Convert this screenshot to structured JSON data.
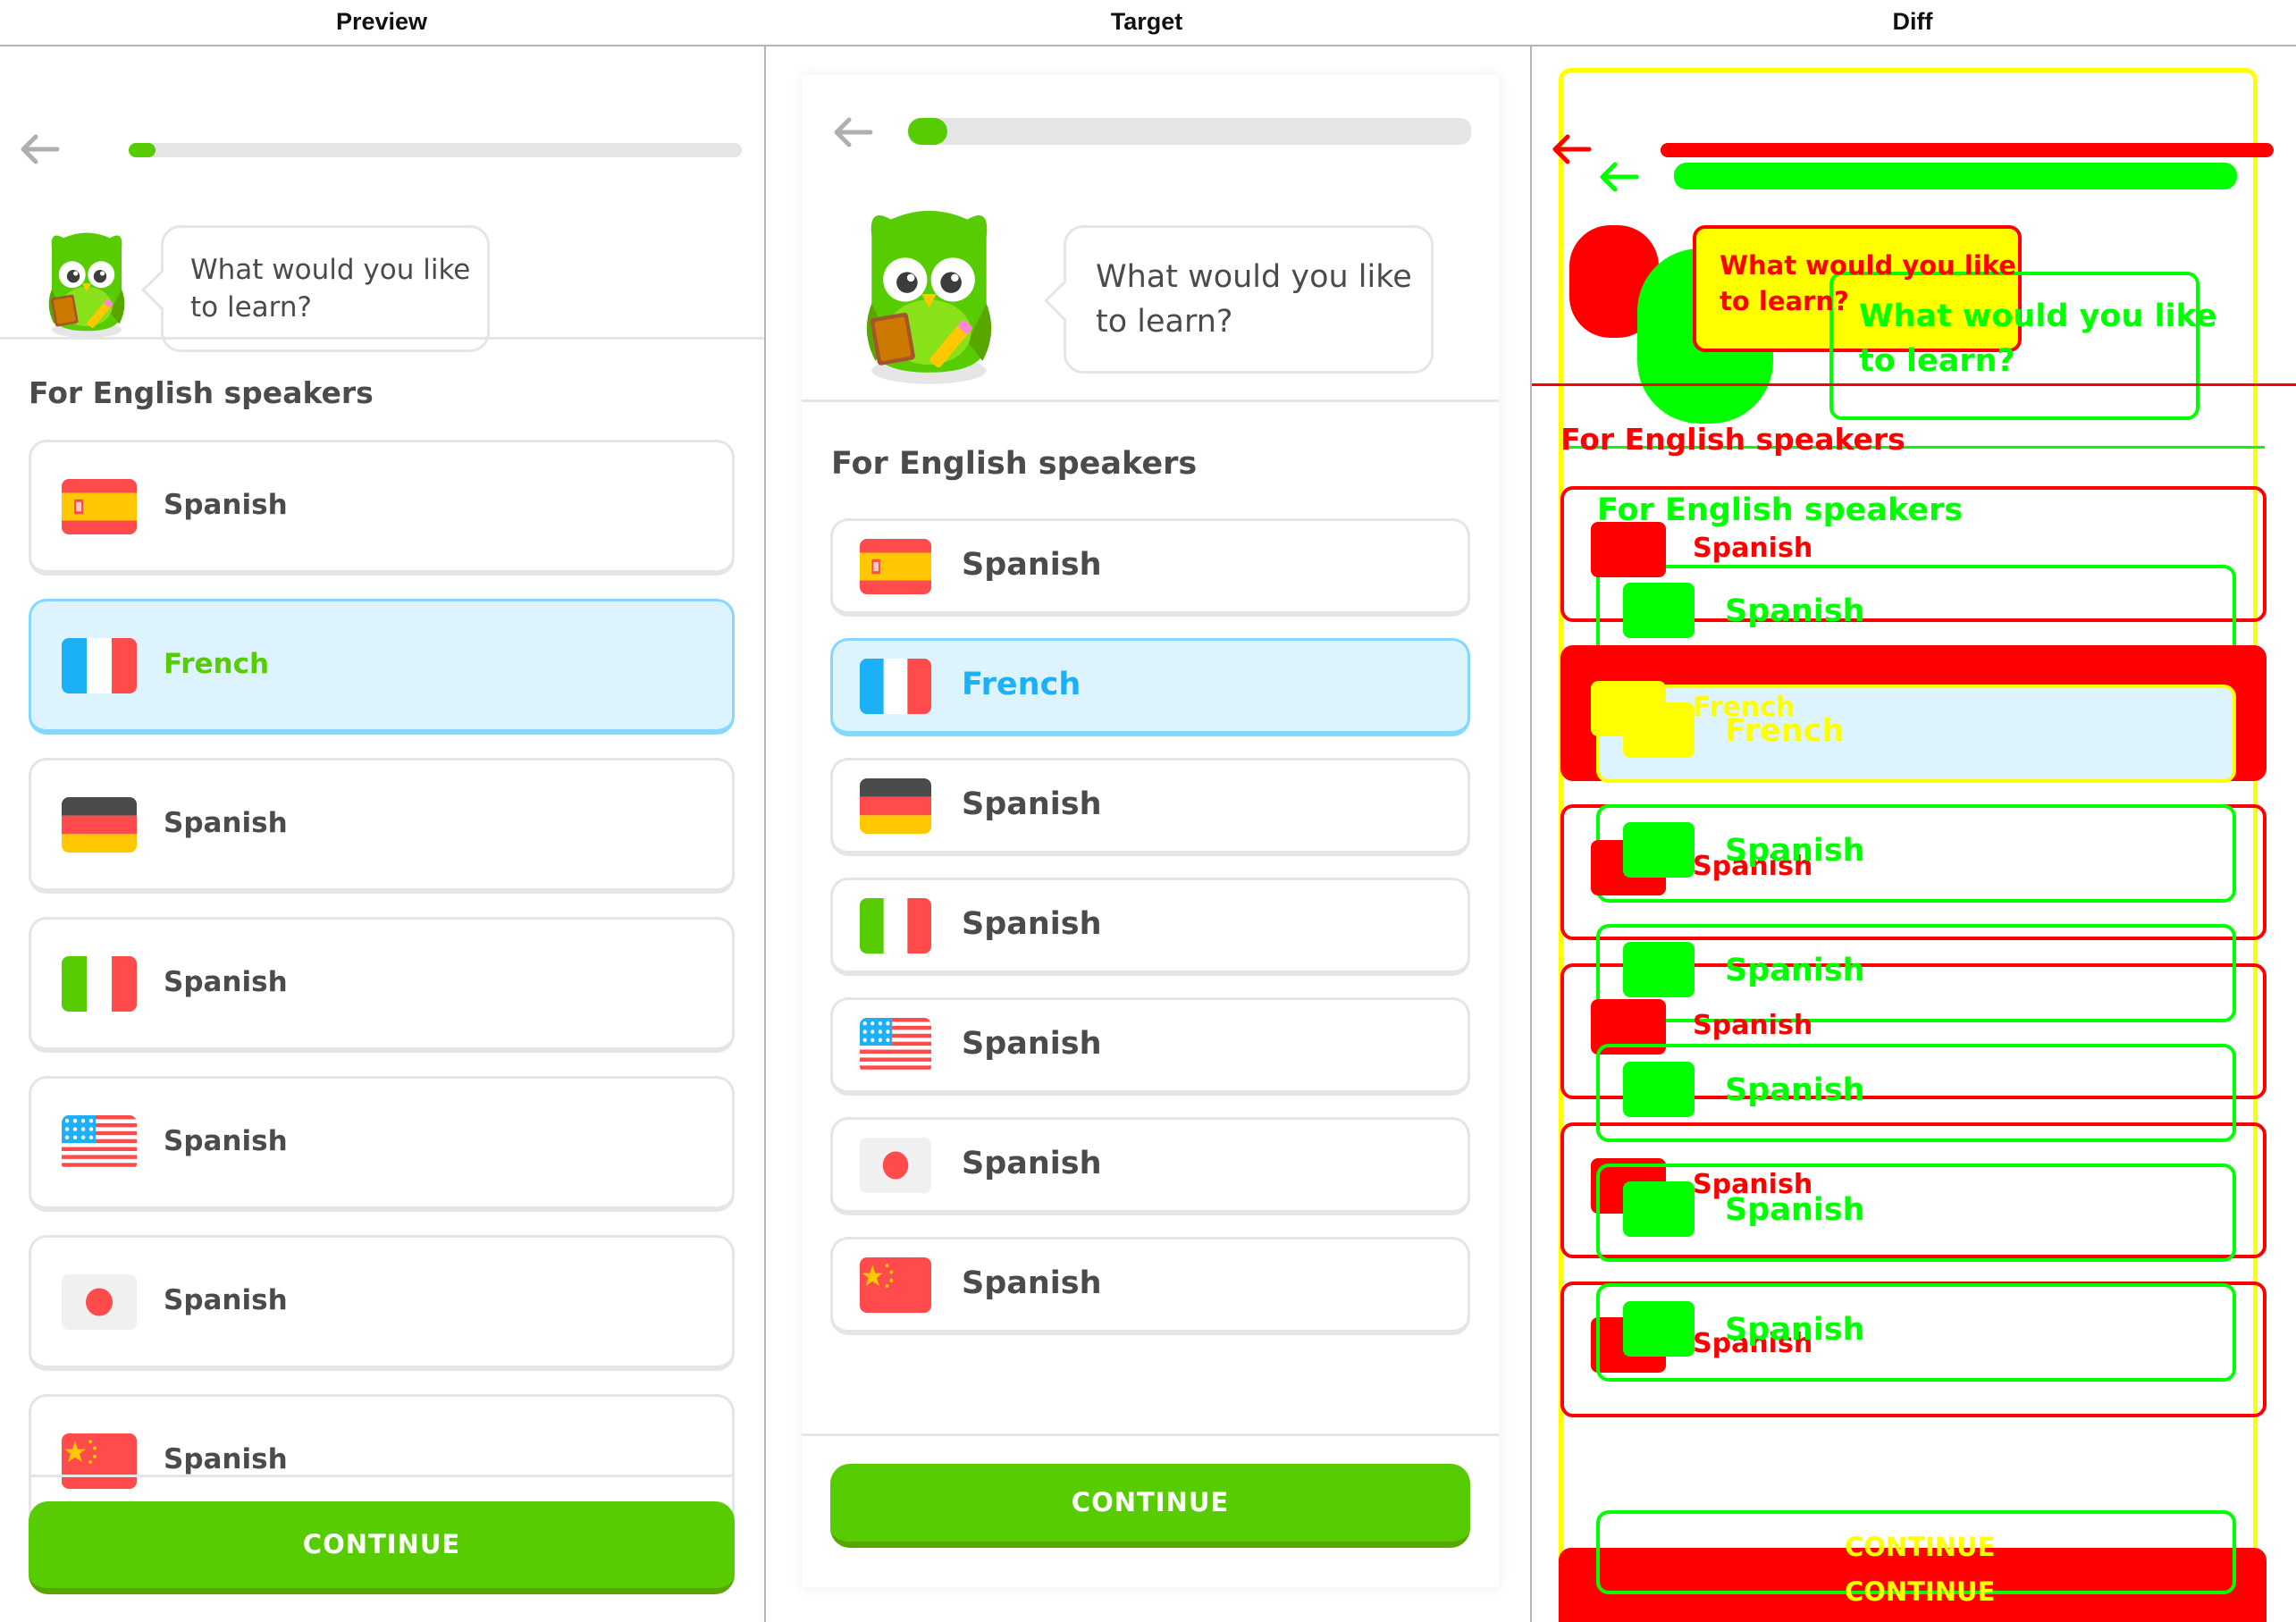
{
  "header": {
    "preview_label": "Preview",
    "target_label": "Target",
    "diff_label": "Diff"
  },
  "app": {
    "prompt": "What would you like to learn?",
    "prompt_line1": "What would you like",
    "prompt_line2": "to learn?",
    "section_title": "For English speakers",
    "continue_label": "CONTINUE",
    "progress_fraction": 0.03,
    "options": [
      {
        "flag": "spain-flag-icon",
        "label": "Spanish",
        "selected": false
      },
      {
        "flag": "france-flag-icon",
        "label": "French",
        "selected": true
      },
      {
        "flag": "germany-flag-icon",
        "label": "Spanish",
        "selected": false
      },
      {
        "flag": "italy-flag-icon",
        "label": "Spanish",
        "selected": false
      },
      {
        "flag": "usa-flag-icon",
        "label": "Spanish",
        "selected": false
      },
      {
        "flag": "japan-flag-icon",
        "label": "Spanish",
        "selected": false
      },
      {
        "flag": "china-flag-icon",
        "label": "Spanish",
        "selected": false
      }
    ]
  },
  "colors": {
    "brand_green": "#58cc02",
    "brand_green_dark": "#58a700",
    "selected_bg": "#ddf4ff",
    "selected_border": "#84d8ff",
    "selected_text_target": "#1cb0f6",
    "selected_text_preview": "#58cc02",
    "text": "#4b4b4b",
    "border": "#e5e5e5",
    "diff_red": "#ff0000",
    "diff_green": "#00ff00",
    "diff_yellow": "#ffff00"
  }
}
